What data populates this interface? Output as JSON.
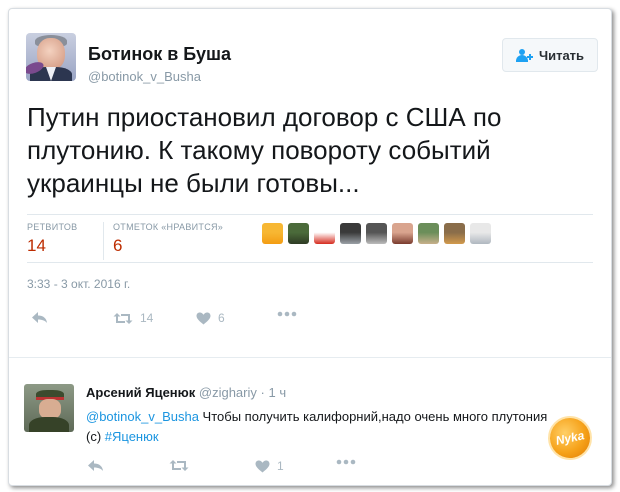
{
  "main_tweet": {
    "author_name": "Ботинок в Буша",
    "author_handle": "@botinok_v_Busha",
    "follow_label": "Читать",
    "text": "Путин приостановил договор с США по плутонию. К такому повороту событий украинцы не были готовы...",
    "retweets_label": "РЕТВИТОВ",
    "retweets_count": "14",
    "likes_label": "ОТМЕТОК «НРАВИТСЯ»",
    "likes_count": "6",
    "timestamp": "3:33 - 3 окт. 2016 г.",
    "actions": {
      "retweet_count": "14",
      "like_count": "6"
    },
    "likers": [
      {
        "name": "liker-avatar-1",
        "colors": [
          "#f7b733",
          "#f39c12"
        ]
      },
      {
        "name": "liker-avatar-2",
        "colors": [
          "#4b6a3a",
          "#2e3b24"
        ]
      },
      {
        "name": "liker-avatar-3",
        "colors": [
          "#ffffff",
          "#d52b1e"
        ]
      },
      {
        "name": "liker-avatar-4",
        "colors": [
          "#3a3a3a",
          "#9aa0a6"
        ]
      },
      {
        "name": "liker-avatar-5",
        "colors": [
          "#555555",
          "#bbbbbb"
        ]
      },
      {
        "name": "liker-avatar-6",
        "colors": [
          "#d9a48e",
          "#7a3b2e"
        ]
      },
      {
        "name": "liker-avatar-7",
        "colors": [
          "#6b8e5a",
          "#c7b08a"
        ]
      },
      {
        "name": "liker-avatar-8",
        "colors": [
          "#8a6d4a",
          "#d29a4c"
        ]
      },
      {
        "name": "liker-avatar-9",
        "colors": [
          "#e8e8e8",
          "#b0b8c0"
        ]
      }
    ]
  },
  "reply_tweet": {
    "author_name": "Арсений Яценюк",
    "author_handle": "@zighariy",
    "time_ago": "1 ч",
    "mention": "@botinok_v_Busha",
    "text_part1": " Чтобы получить калифорний,надо очень много плутония (с) ",
    "hashtag": "#Яценюк",
    "actions": {
      "like_count": "1"
    }
  },
  "watermark": {
    "text": "Nyka"
  },
  "colors": {
    "accent": "#1da1f2",
    "count": "#bd2c00",
    "muted": "#8899a6",
    "link": "#1b95e0",
    "icon": "#aab8c2"
  }
}
